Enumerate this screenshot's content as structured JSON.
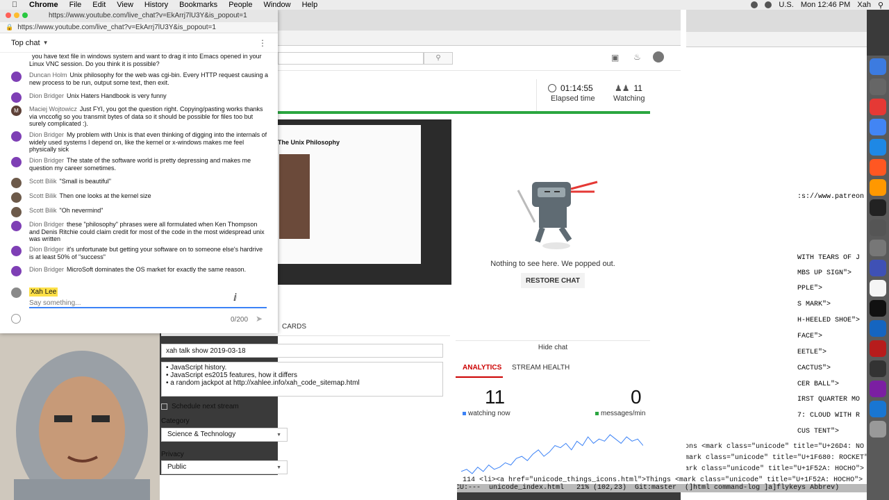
{
  "menubar": {
    "app": "Chrome",
    "items": [
      "File",
      "Edit",
      "View",
      "History",
      "Bookmarks",
      "People",
      "Window",
      "Help"
    ],
    "clock": "Mon 12:46 PM",
    "user": "Xah",
    "lang": "U.S."
  },
  "chat": {
    "title_url": "https://www.youtube.com/live_chat?v=EkArrj7lU3Y&is_popout=1",
    "url": "https://www.youtube.com/live_chat?v=EkArrj7lU3Y&is_popout=1",
    "header": "Top chat",
    "messages": [
      {
        "author": "",
        "text": "you have text file in windows system and want to drag it into Emacs opened in your Linux VNC session. Do you think it is possible?",
        "avatar_color": "#7e3fb5"
      },
      {
        "author": "Duncan Holm",
        "text": "Unix philosophy for the web was cgi-bin. Every HTTP request causing a new process to be run, output some text, then exit.",
        "avatar_color": "#7e3fb5"
      },
      {
        "author": "Dion Bridger",
        "text": "Unix Haters Handbook is very funny",
        "avatar_color": "#7e3fb5"
      },
      {
        "author": "Maciej Wojtowicz",
        "text": "Just FYI, you got the question right. Copying/pasting works thanks via vnccofig so you transmit bytes of data so it should be possible for files too but surely complicated :).",
        "avatar_color": "#5d4037",
        "avatar_letter": "M"
      },
      {
        "author": "Dion Bridger",
        "text": "My problem with Unix is that even thinking of digging into the internals of widely used systems I depend on, like the kernel or x-windows makes me feel physically sick",
        "avatar_color": "#7e3fb5"
      },
      {
        "author": "Dion Bridger",
        "text": "The state of the software world is pretty depressing and makes me question my career sometimes.",
        "avatar_color": "#7e3fb5"
      },
      {
        "author": "Scott Bilik",
        "text": "\"Small is beautiful\"",
        "avatar_color": "#6d5a4a"
      },
      {
        "author": "Scott Bilik",
        "text": "Then one looks at the kernel size",
        "avatar_color": "#6d5a4a"
      },
      {
        "author": "Scott Bilik",
        "text": "\"Oh nevermind\"",
        "avatar_color": "#6d5a4a"
      },
      {
        "author": "Dion Bridger",
        "text": "these \"philosophy\" phrases were all formulated when Ken Thompson and Denis Ritchie could claim credit for most of the code in the most widespread unix was written",
        "avatar_color": "#7e3fb5"
      },
      {
        "author": "Dion Bridger",
        "text": "it's unfortunate but getting your software on to someone else's hardrive is at least 50% of \"success\"",
        "avatar_color": "#7e3fb5"
      },
      {
        "author": "Dion Bridger",
        "text": "MicroSoft dominates the OS market for exactly the same reason.",
        "avatar_color": "#7e3fb5"
      }
    ],
    "composer_name": "Xah Lee",
    "composer_placeholder": "Say something...",
    "counter": "0/200"
  },
  "studio": {
    "elapsed_value": "01:14:55",
    "elapsed_label": "Elapsed time",
    "watching_value": "11",
    "watching_label": "Watching",
    "preview_title": "The Unix Philosophy",
    "popped_text": "Nothing to see here. We popped out.",
    "restore_label": "RESTORE CHAT",
    "hide_chat": "Hide chat",
    "cards_tab": "CARDS",
    "stream_title": "xah talk show 2019-03-18",
    "description_lines": [
      "• JavaScript history.",
      "• JavaScript es2015 features, how it differs",
      "• a random jackpot at http://xahlee.info/xah_code_sitemap.html"
    ],
    "schedule": "Schedule next stream",
    "category_label": "Category",
    "category_value": "Science & Technology",
    "privacy_label": "Privacy",
    "privacy_value": "Public",
    "analytics_tab": "ANALYTICS",
    "stream_health_tab": "STREAM HEALTH",
    "watching_now_value": "11",
    "watching_now_label": "watching now",
    "messages_value": "0",
    "messages_label": "messages/min",
    "sparkline": [
      2,
      3,
      1,
      4,
      2,
      5,
      3,
      4,
      6,
      5,
      8,
      9,
      7,
      10,
      12,
      9,
      11,
      14,
      13,
      15,
      12,
      16,
      14,
      18,
      15,
      17,
      16,
      19,
      17,
      15,
      18,
      16,
      17,
      14
    ]
  },
  "editor": {
    "lines": [
      ":s://www.patreon",
      "WITH TEARS OF J",
      "MBS UP SIGN\">",
      "PPLE\">",
      "S MARK\">",
      "H-HEELED SHOE\">",
      " FACE\">",
      "EETLE\">",
      "CACTUS\">",
      "CER BALL\">",
      "IRST QUARTER MO",
      "7: CLOUD WITH R",
      "CUS TENT\">"
    ],
    "bottom_lines": [
      "ons <mark class=\"unicode\" title=\"U+26D4: NO EN",
      "mark class=\"unicode\" title=\"U+1F680: ROCKET\">",
      "ark class=\"unicode\" title=\"U+1F52A: HOCHO\">",
      "114 <li><a href=\"unicode_things_icons.html\">Things <mark class=\"unicode\" title=\"U+1F52A: HOCHO\">"
    ],
    "modeline": "CU:---  unicode_index.html   21% (102,23)  Git:master  (]html command-log ]a]flykeys Abbrev)"
  },
  "colors": {
    "accent_red": "#cc0000",
    "green": "#2ba640",
    "blue_input": "#3b82f6",
    "highlight": "#fde047"
  }
}
